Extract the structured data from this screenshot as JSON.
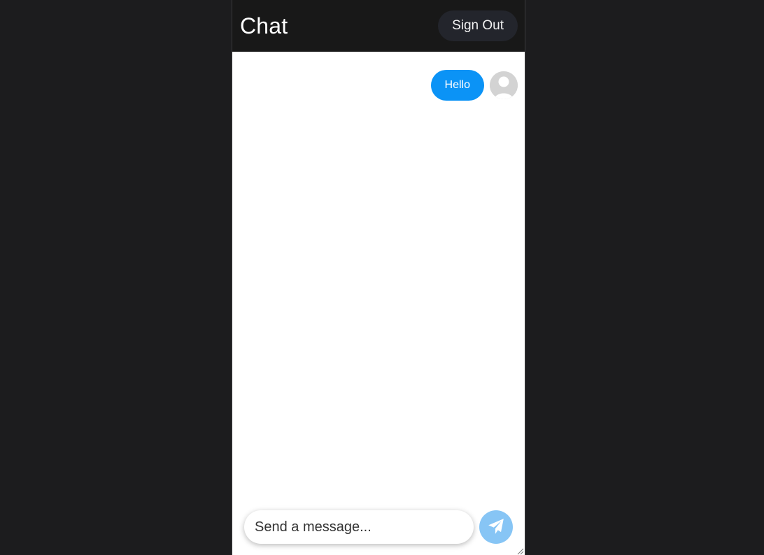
{
  "header": {
    "title": "Chat",
    "signout_label": "Sign Out"
  },
  "messages": [
    {
      "text": "Hello",
      "sent": true
    }
  ],
  "composer": {
    "placeholder": "Send a message...",
    "value": ""
  },
  "icons": {
    "send": "paper-plane-icon",
    "avatar": "user-avatar-icon"
  },
  "colors": {
    "background": "#1c1c1e",
    "header": "#181818",
    "bubble_sent": "#0b93f6",
    "send_button": "#87c5f5",
    "signout_button": "#23252c"
  }
}
